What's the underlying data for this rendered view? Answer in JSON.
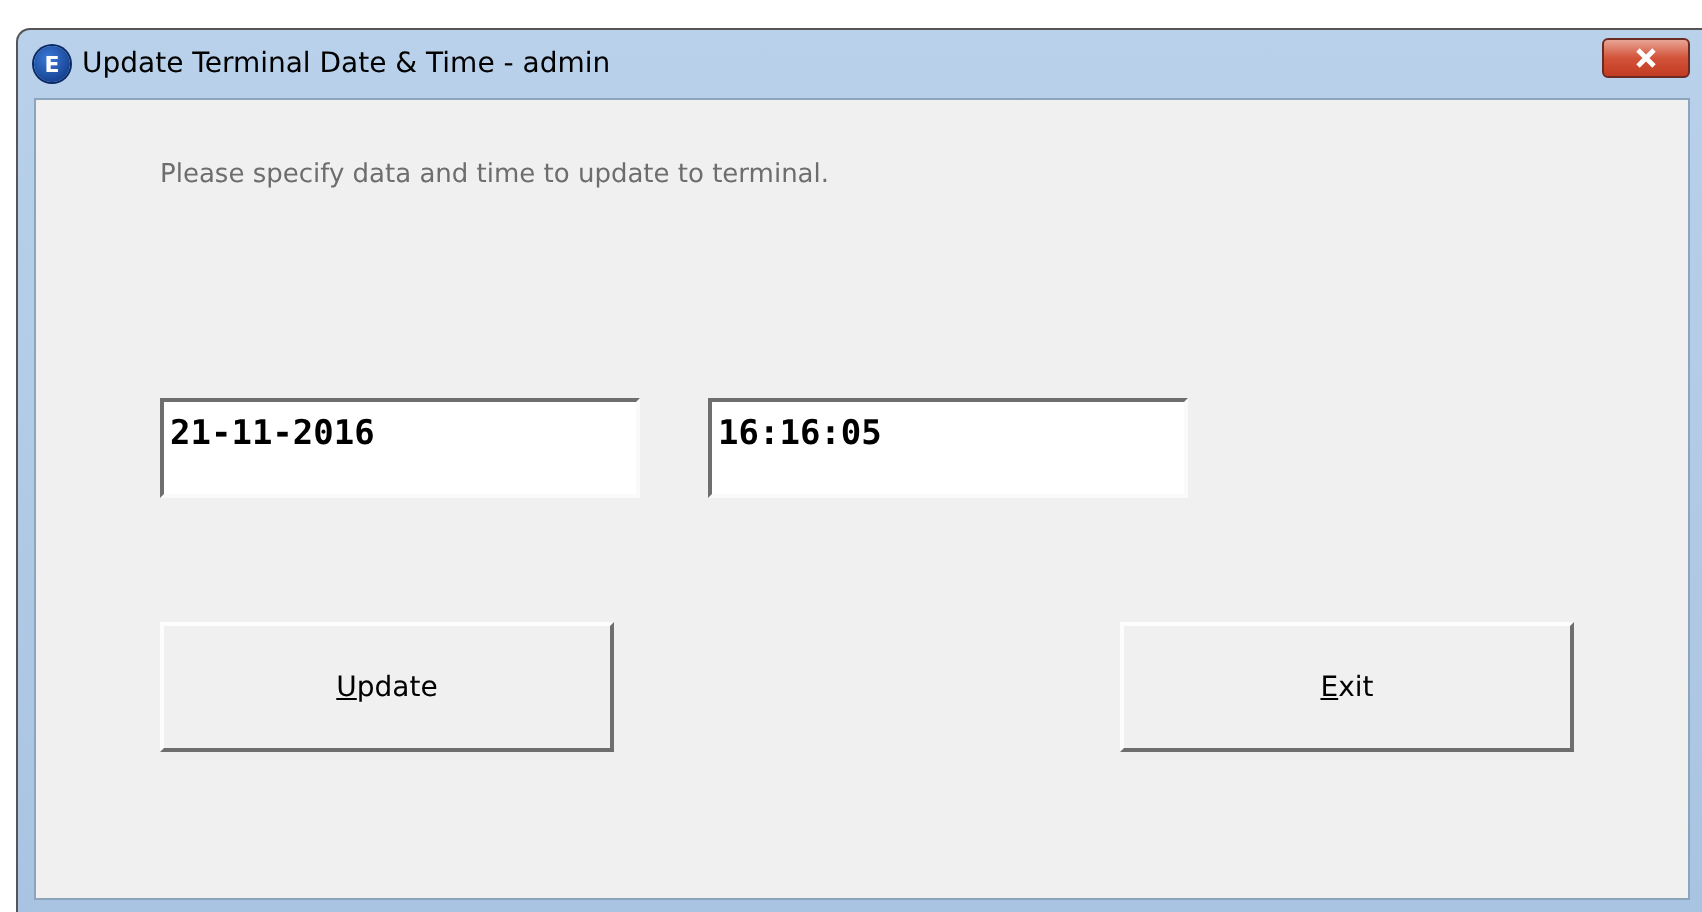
{
  "window": {
    "title": "Update Terminal Date & Time - admin",
    "app_icon": "E"
  },
  "instruction": "Please specify data and time to update to terminal.",
  "fields": [
    {
      "value": "21-11-2016"
    },
    {
      "value": "16:16:05"
    }
  ],
  "buttons": [
    {
      "access_key": "U",
      "label_rest": "pdate"
    },
    {
      "access_key": "E",
      "label_rest": "xit"
    }
  ]
}
